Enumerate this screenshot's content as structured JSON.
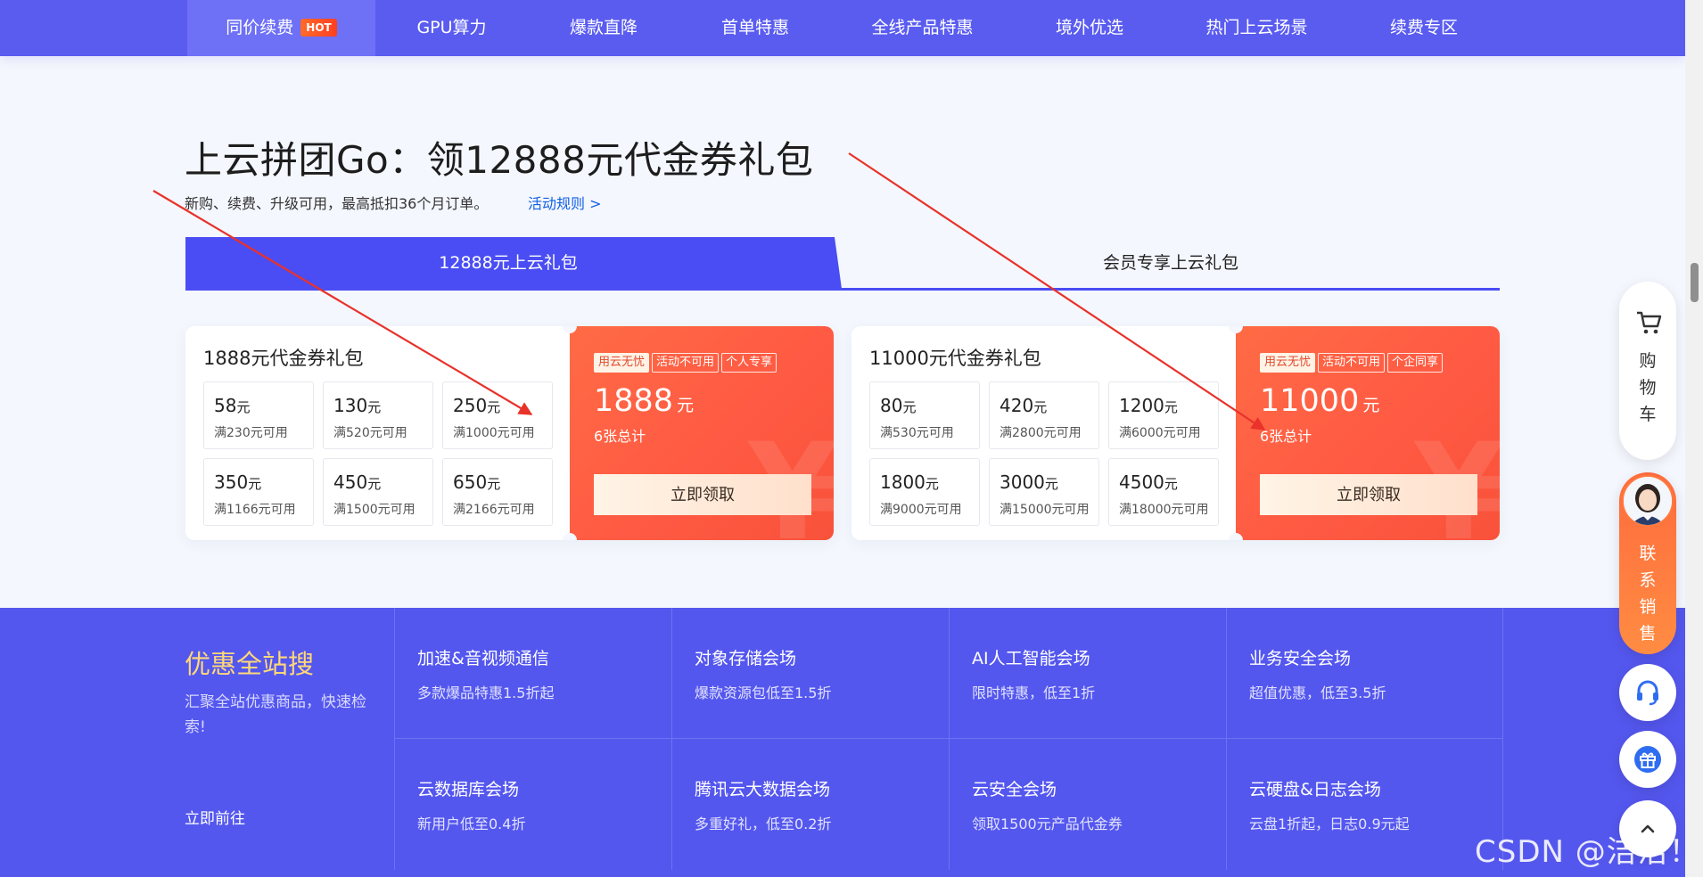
{
  "nav": {
    "items": [
      {
        "label": "同价续费",
        "badge": "HOT"
      },
      {
        "label": "GPU算力"
      },
      {
        "label": "爆款直降"
      },
      {
        "label": "首单特惠"
      },
      {
        "label": "全线产品特惠"
      },
      {
        "label": "境外优选"
      },
      {
        "label": "热门上云场景"
      },
      {
        "label": "续费专区"
      }
    ]
  },
  "hero": {
    "title": "上云拼团Go：领12888元代金券礼包",
    "subtitle": "新购、续费、升级可用，最高抵扣36个月订单。",
    "rules_link": "活动规则 >"
  },
  "tabs": {
    "active": "12888元上云礼包",
    "inactive": "会员专享上云礼包"
  },
  "cards": [
    {
      "title": "1888元代金券礼包",
      "coupons": [
        {
          "amount": "58",
          "unit": "元",
          "cond": "满230元可用"
        },
        {
          "amount": "130",
          "unit": "元",
          "cond": "满520元可用"
        },
        {
          "amount": "250",
          "unit": "元",
          "cond": "满1000元可用"
        },
        {
          "amount": "350",
          "unit": "元",
          "cond": "满1166元可用"
        },
        {
          "amount": "450",
          "unit": "元",
          "cond": "满1500元可用"
        },
        {
          "amount": "650",
          "unit": "元",
          "cond": "满2166元可用"
        }
      ],
      "tags": [
        "用云无忧",
        "活动不可用",
        "个人专享"
      ],
      "amount": "1888",
      "unit": "元",
      "count": "6张总计",
      "button": "立即领取"
    },
    {
      "title": "11000元代金券礼包",
      "coupons": [
        {
          "amount": "80",
          "unit": "元",
          "cond": "满530元可用"
        },
        {
          "amount": "420",
          "unit": "元",
          "cond": "满2800元可用"
        },
        {
          "amount": "1200",
          "unit": "元",
          "cond": "满6000元可用"
        },
        {
          "amount": "1800",
          "unit": "元",
          "cond": "满9000元可用"
        },
        {
          "amount": "3000",
          "unit": "元",
          "cond": "满15000元可用"
        },
        {
          "amount": "4500",
          "unit": "元",
          "cond": "满18000元可用"
        }
      ],
      "tags": [
        "用云无忧",
        "活动不可用",
        "个企同享"
      ],
      "amount": "11000",
      "unit": "元",
      "count": "6张总计",
      "button": "立即领取"
    }
  ],
  "search_band": {
    "title": "优惠全站搜",
    "desc": "汇聚全站优惠商品，快速检索!",
    "go": "立即前往",
    "items": [
      {
        "title": "加速&音视频通信",
        "desc": "多款爆品特惠1.5折起"
      },
      {
        "title": "对象存储会场",
        "desc": "爆款资源包低至1.5折"
      },
      {
        "title": "AI人工智能会场",
        "desc": "限时特惠，低至1折"
      },
      {
        "title": "业务安全会场",
        "desc": "超值优惠，低至3.5折"
      },
      {
        "title": "云数据库会场",
        "desc": "新用户低至0.4折"
      },
      {
        "title": "腾讯云大数据会场",
        "desc": "多重好礼，低至0.2折"
      },
      {
        "title": "云安全会场",
        "desc": "领取1500元产品代金券"
      },
      {
        "title": "云硬盘&日志会场",
        "desc": "云盘1折起，日志0.9元起"
      }
    ]
  },
  "float": {
    "cart": [
      "购",
      "物",
      "车"
    ],
    "sales": [
      "联",
      "系",
      "销",
      "售"
    ],
    "icons": [
      "cart-icon",
      "headset-icon",
      "gift-icon",
      "chevron-up-icon"
    ]
  },
  "watermark": "CSDN @洁洁！",
  "colors": {
    "nav_bg": "#5a5cf0",
    "tab_active": "#4a4df3",
    "promo_orange": "#ff5a43",
    "band_bg": "#5457ee",
    "band_title": "#ffd878",
    "link_blue": "#1260e6",
    "annotation_arrow": "#e8322a"
  }
}
